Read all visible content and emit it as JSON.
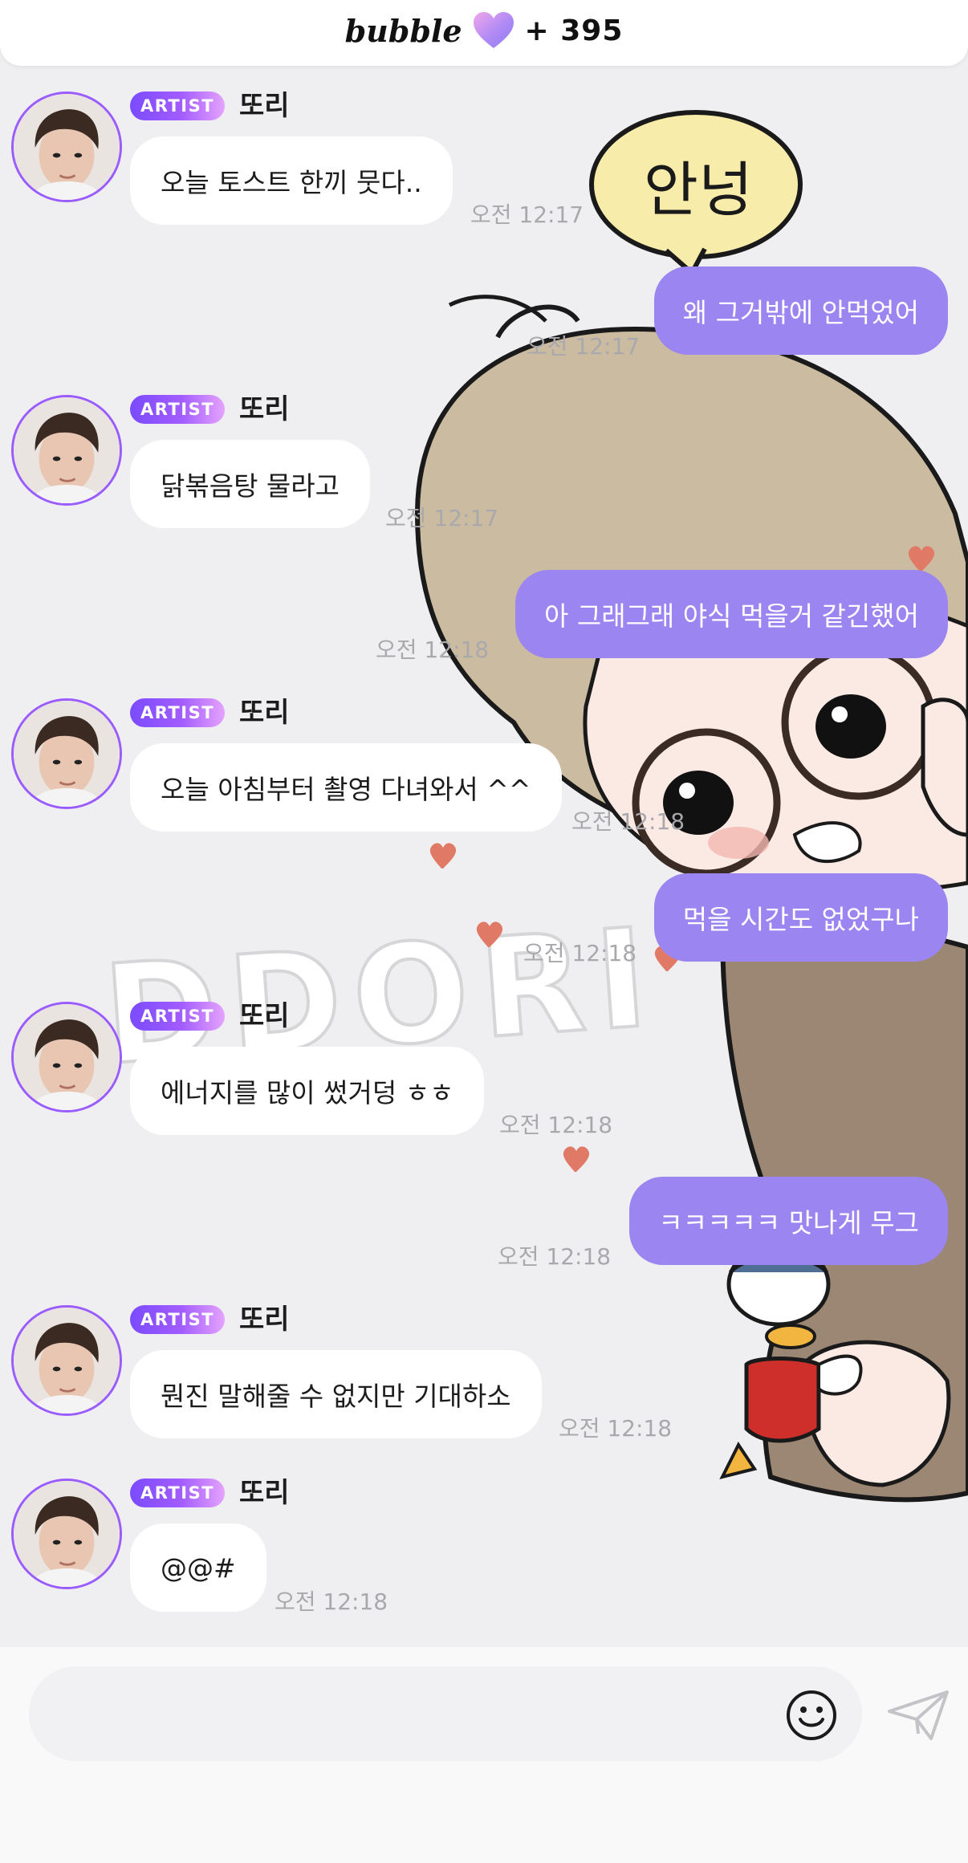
{
  "header": {
    "brand_word": "bubble",
    "count": "+ 395"
  },
  "background": {
    "speech_text": "안넝",
    "watermark_text": "DDORI"
  },
  "messages": [
    {
      "from": "artist",
      "badge": "ARTIST",
      "name": "또리",
      "text": "오늘 토스트 한끼 뭇다..",
      "time": "오전 12:17"
    },
    {
      "from": "me",
      "text": "왜 그거밖에 안먹었어",
      "time": "오전 12:17"
    },
    {
      "from": "artist",
      "badge": "ARTIST",
      "name": "또리",
      "text": "닭볶음탕 물라고",
      "time": "오전 12:17"
    },
    {
      "from": "me",
      "text": "아 그래그래 야식 먹을거 같긴했어",
      "time": "오전 12:18"
    },
    {
      "from": "artist",
      "badge": "ARTIST",
      "name": "또리",
      "text": "오늘 아침부터 촬영 다녀와서 ^^",
      "time": "오전 12:18"
    },
    {
      "from": "me",
      "text": "먹을 시간도 없었구나",
      "time": "오전 12:18"
    },
    {
      "from": "artist",
      "badge": "ARTIST",
      "name": "또리",
      "text": "에너지를 많이 썼거덩 ㅎㅎ",
      "time": "오전 12:18"
    },
    {
      "from": "me",
      "text": "ㅋㅋㅋㅋㅋ 맛나게 무그",
      "time": "오전 12:18"
    },
    {
      "from": "artist",
      "badge": "ARTIST",
      "name": "또리",
      "text": "뭔진 말해줄 수 없지만 기대하소",
      "time": "오전 12:18"
    },
    {
      "from": "artist",
      "badge": "ARTIST",
      "name": "또리",
      "text": "@@#",
      "time": "오전 12:18"
    }
  ],
  "composer": {
    "input_value": "",
    "input_placeholder": "",
    "emoji_icon": "smiley-icon",
    "send_icon": "paper-plane-icon"
  },
  "colors": {
    "outgoing_bubble": "#9b85f0",
    "incoming_bubble": "#ffffff",
    "background": "#efeff1",
    "badge_gradient_start": "#7a4bff",
    "badge_gradient_end": "#e5a3ff",
    "timestamp": "#a9a9ad"
  }
}
